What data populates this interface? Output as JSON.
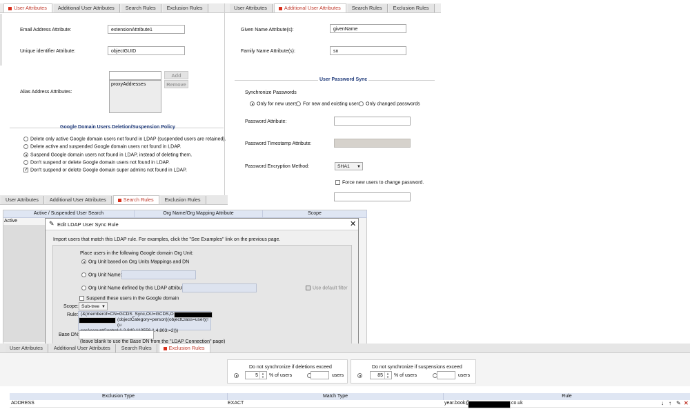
{
  "tabs": [
    "User Attributes",
    "Additional User Attributes",
    "Search Rules",
    "Exclusion Rules"
  ],
  "user_attributes": {
    "email_label": "Email Address Attribute:",
    "email_value": "extensionAttribute1",
    "uid_label": "Unique identifier Attribute:",
    "uid_value": "objectGUID",
    "alias_label": "Alias Address Attributes:",
    "alias_input": "",
    "alias_list": [
      "proxyAddresses"
    ],
    "add_button": "Add",
    "remove_button": "Remove",
    "deletion_heading": "Google Domain Users Deletion/Suspension Policy",
    "deletion_options": [
      "Delete only active Google domain users not found in LDAP (suspended users are retained).",
      "Delete active and suspended Google domain users not found in LDAP.",
      "Suspend Google domain users not found in LDAP, instead of deleting them.",
      "Don't suspend or delete Google domain users not found in LDAP."
    ],
    "deletion_selected": 2,
    "super_admin_checkbox": "Don't suspend or delete Google domain super admins not found in LDAP.",
    "super_admin_checked": true
  },
  "additional_attributes": {
    "given_label": "Given Name Attribute(s):",
    "given_value": "givenName",
    "family_label": "Family Name Attribute(s):",
    "family_value": "sn",
    "pw_heading": "User Password Sync",
    "sync_label": "Synchronize Passwords",
    "sync_options": [
      "Only for new users",
      "For new and existing users",
      "Only changed passwords"
    ],
    "sync_selected": 0,
    "pw_attr_label": "Password Attribute:",
    "pw_attr_value": "",
    "pw_ts_label": "Password Timestamp Attribute:",
    "pw_enc_label": "Password Encryption Method:",
    "pw_enc_value": "SHA1",
    "force_change": "Force new users to change password.",
    "force_checked": false
  },
  "search_rules": {
    "columns": [
      "Active / Suspended User Search",
      "Org Name/Org Mapping Attribute",
      "Scope"
    ],
    "row_first": "Active"
  },
  "dialog": {
    "title": "Edit LDAP User Sync Rule",
    "intro": "Import users that match this LDAP rule.  For examples, click the \"See Examples\" link on the previous page.",
    "place_label": "Place users in the following Google domain Org Unit:",
    "org_options": [
      "Org Unit based on Org Units Mappings and DN",
      "Org Unit Name:",
      "Org Unit Name defined by this LDAP attribute:"
    ],
    "org_selected": 0,
    "use_default_filter": "Use default filter",
    "suspend_label": "Suspend these users in the Google domain",
    "scope_label": "Scope:",
    "scope_value": "Sub-tree",
    "rule_label": "Rule:",
    "rule_line1": "(&(memberof=CN=GCDS_Sync,OU=GCDS,OU=",
    "rule_line2": "(objectCategory=person)(objectClass=user)(!(u",
    "rule_line3": "serAccountControl:1.2.840.113556.1.4.803:=2)))",
    "base_dn_label": "Base DN:",
    "base_dn_hint": "(leave blank to use the Base DN from the \"LDAP Connection\" page)"
  },
  "exclusion": {
    "del_title": "Do not synchronize if deletions exceed",
    "del_value": "5",
    "susp_title": "Do not synchronize if suspensions exceed",
    "susp_value": "85",
    "pct_users": "% of users",
    "users": "users",
    "columns": [
      "Exclusion Type",
      "Match Type",
      "Rule"
    ],
    "row": {
      "type": "ADDRESS",
      "match": "EXACT",
      "rule_prefix": "year.book@",
      "rule_suffix": ".co.uk"
    }
  },
  "colors": {
    "active_tab": "#c0392b",
    "heading": "#1f3a7a",
    "table_header": "#dfe6f3"
  }
}
